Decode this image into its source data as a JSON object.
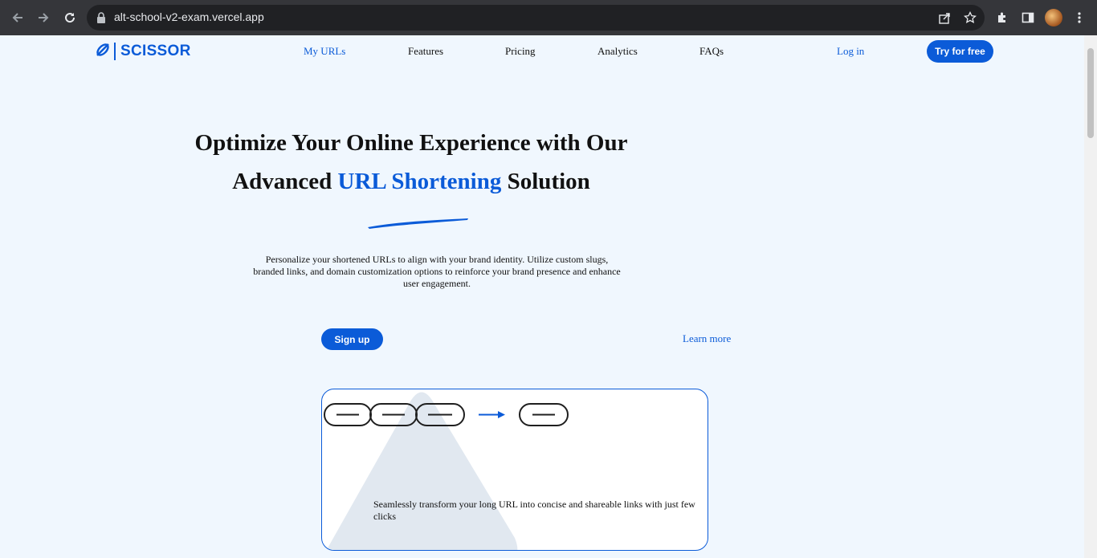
{
  "browser": {
    "url": "alt-school-v2-exam.vercel.app",
    "icons": [
      "back-arrow-icon",
      "forward-arrow-icon",
      "reload-icon",
      "lock-icon",
      "share-icon",
      "star-icon",
      "puzzle-icon",
      "side-panel-icon",
      "avatar",
      "kebab-menu-icon"
    ]
  },
  "header": {
    "logo_text": "SCISSOR",
    "nav": [
      "My URLs",
      "Features",
      "Pricing",
      "Analytics",
      "FAQs"
    ],
    "login": "Log in",
    "cta": "Try for free"
  },
  "hero": {
    "title_line1": "Optimize Your Online Experience with Our",
    "title_line2_a": "Advanced ",
    "title_line2_highlight": "URL Shortening",
    "title_line2_b": " Solution",
    "description": "Personalize your shortened URLs to align with your brand identity. Utilize custom slugs, branded links, and domain customization options to reinforce your brand presence and enhance user engagement.",
    "signup": "Sign up",
    "learn_more": "Learn more"
  },
  "card": {
    "caption": "Seamlessly transform your long URL into concise and shareable links with just few clicks"
  },
  "colors": {
    "accent": "#0b5bd8",
    "page_bg": "#f0f7fe"
  }
}
